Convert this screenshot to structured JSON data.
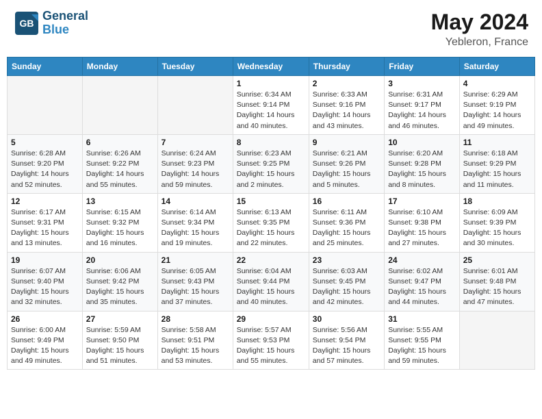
{
  "header": {
    "logo_line1": "General",
    "logo_line2": "Blue",
    "title": "May 2024",
    "location": "Yebleron, France"
  },
  "weekdays": [
    "Sunday",
    "Monday",
    "Tuesday",
    "Wednesday",
    "Thursday",
    "Friday",
    "Saturday"
  ],
  "weeks": [
    [
      {
        "day": "",
        "info": ""
      },
      {
        "day": "",
        "info": ""
      },
      {
        "day": "",
        "info": ""
      },
      {
        "day": "1",
        "info": "Sunrise: 6:34 AM\nSunset: 9:14 PM\nDaylight: 14 hours\nand 40 minutes."
      },
      {
        "day": "2",
        "info": "Sunrise: 6:33 AM\nSunset: 9:16 PM\nDaylight: 14 hours\nand 43 minutes."
      },
      {
        "day": "3",
        "info": "Sunrise: 6:31 AM\nSunset: 9:17 PM\nDaylight: 14 hours\nand 46 minutes."
      },
      {
        "day": "4",
        "info": "Sunrise: 6:29 AM\nSunset: 9:19 PM\nDaylight: 14 hours\nand 49 minutes."
      }
    ],
    [
      {
        "day": "5",
        "info": "Sunrise: 6:28 AM\nSunset: 9:20 PM\nDaylight: 14 hours\nand 52 minutes."
      },
      {
        "day": "6",
        "info": "Sunrise: 6:26 AM\nSunset: 9:22 PM\nDaylight: 14 hours\nand 55 minutes."
      },
      {
        "day": "7",
        "info": "Sunrise: 6:24 AM\nSunset: 9:23 PM\nDaylight: 14 hours\nand 59 minutes."
      },
      {
        "day": "8",
        "info": "Sunrise: 6:23 AM\nSunset: 9:25 PM\nDaylight: 15 hours\nand 2 minutes."
      },
      {
        "day": "9",
        "info": "Sunrise: 6:21 AM\nSunset: 9:26 PM\nDaylight: 15 hours\nand 5 minutes."
      },
      {
        "day": "10",
        "info": "Sunrise: 6:20 AM\nSunset: 9:28 PM\nDaylight: 15 hours\nand 8 minutes."
      },
      {
        "day": "11",
        "info": "Sunrise: 6:18 AM\nSunset: 9:29 PM\nDaylight: 15 hours\nand 11 minutes."
      }
    ],
    [
      {
        "day": "12",
        "info": "Sunrise: 6:17 AM\nSunset: 9:31 PM\nDaylight: 15 hours\nand 13 minutes."
      },
      {
        "day": "13",
        "info": "Sunrise: 6:15 AM\nSunset: 9:32 PM\nDaylight: 15 hours\nand 16 minutes."
      },
      {
        "day": "14",
        "info": "Sunrise: 6:14 AM\nSunset: 9:34 PM\nDaylight: 15 hours\nand 19 minutes."
      },
      {
        "day": "15",
        "info": "Sunrise: 6:13 AM\nSunset: 9:35 PM\nDaylight: 15 hours\nand 22 minutes."
      },
      {
        "day": "16",
        "info": "Sunrise: 6:11 AM\nSunset: 9:36 PM\nDaylight: 15 hours\nand 25 minutes."
      },
      {
        "day": "17",
        "info": "Sunrise: 6:10 AM\nSunset: 9:38 PM\nDaylight: 15 hours\nand 27 minutes."
      },
      {
        "day": "18",
        "info": "Sunrise: 6:09 AM\nSunset: 9:39 PM\nDaylight: 15 hours\nand 30 minutes."
      }
    ],
    [
      {
        "day": "19",
        "info": "Sunrise: 6:07 AM\nSunset: 9:40 PM\nDaylight: 15 hours\nand 32 minutes."
      },
      {
        "day": "20",
        "info": "Sunrise: 6:06 AM\nSunset: 9:42 PM\nDaylight: 15 hours\nand 35 minutes."
      },
      {
        "day": "21",
        "info": "Sunrise: 6:05 AM\nSunset: 9:43 PM\nDaylight: 15 hours\nand 37 minutes."
      },
      {
        "day": "22",
        "info": "Sunrise: 6:04 AM\nSunset: 9:44 PM\nDaylight: 15 hours\nand 40 minutes."
      },
      {
        "day": "23",
        "info": "Sunrise: 6:03 AM\nSunset: 9:45 PM\nDaylight: 15 hours\nand 42 minutes."
      },
      {
        "day": "24",
        "info": "Sunrise: 6:02 AM\nSunset: 9:47 PM\nDaylight: 15 hours\nand 44 minutes."
      },
      {
        "day": "25",
        "info": "Sunrise: 6:01 AM\nSunset: 9:48 PM\nDaylight: 15 hours\nand 47 minutes."
      }
    ],
    [
      {
        "day": "26",
        "info": "Sunrise: 6:00 AM\nSunset: 9:49 PM\nDaylight: 15 hours\nand 49 minutes."
      },
      {
        "day": "27",
        "info": "Sunrise: 5:59 AM\nSunset: 9:50 PM\nDaylight: 15 hours\nand 51 minutes."
      },
      {
        "day": "28",
        "info": "Sunrise: 5:58 AM\nSunset: 9:51 PM\nDaylight: 15 hours\nand 53 minutes."
      },
      {
        "day": "29",
        "info": "Sunrise: 5:57 AM\nSunset: 9:53 PM\nDaylight: 15 hours\nand 55 minutes."
      },
      {
        "day": "30",
        "info": "Sunrise: 5:56 AM\nSunset: 9:54 PM\nDaylight: 15 hours\nand 57 minutes."
      },
      {
        "day": "31",
        "info": "Sunrise: 5:55 AM\nSunset: 9:55 PM\nDaylight: 15 hours\nand 59 minutes."
      },
      {
        "day": "",
        "info": ""
      }
    ]
  ]
}
